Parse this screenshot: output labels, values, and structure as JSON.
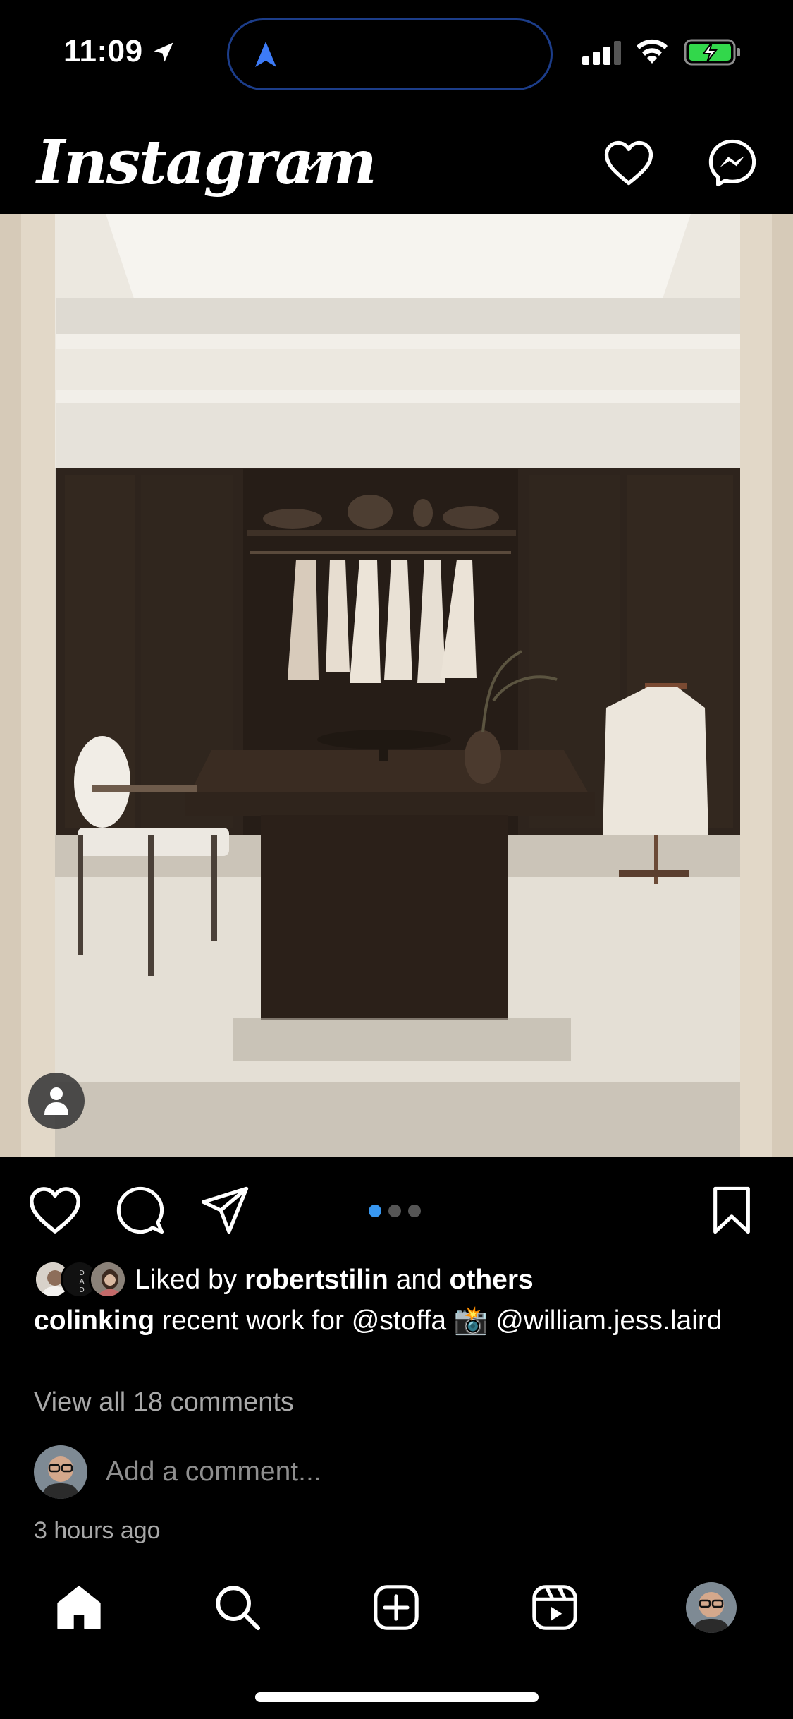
{
  "status_bar": {
    "time": "11:09",
    "icons": [
      "location-arrow-icon",
      "navigation-icon",
      "signal-icon",
      "wifi-icon",
      "battery-charging-icon"
    ],
    "battery_color": "#32d74b"
  },
  "header": {
    "logo": "Instagram",
    "icons": [
      "chevron-down-icon",
      "heart-icon",
      "messenger-icon"
    ]
  },
  "post": {
    "carousel": {
      "count": 3,
      "active_index": 0
    },
    "likes": {
      "prefix": "Liked by ",
      "user": "robertstilin",
      "middle": " and ",
      "suffix": "others"
    },
    "caption": {
      "username": "colinking",
      "text": " recent work for @stoffa 📸 @william.jess.laird"
    },
    "view_comments": "View all 18 comments",
    "add_comment_placeholder": "Add a comment...",
    "timestamp": "3 hours ago"
  },
  "colors": {
    "accent_blue": "#3897f0",
    "secondary_text": "#a8a8a8",
    "background": "#000000"
  },
  "bottom_nav": {
    "items": [
      "home-icon",
      "search-icon",
      "create-icon",
      "reels-icon",
      "profile-avatar"
    ]
  }
}
